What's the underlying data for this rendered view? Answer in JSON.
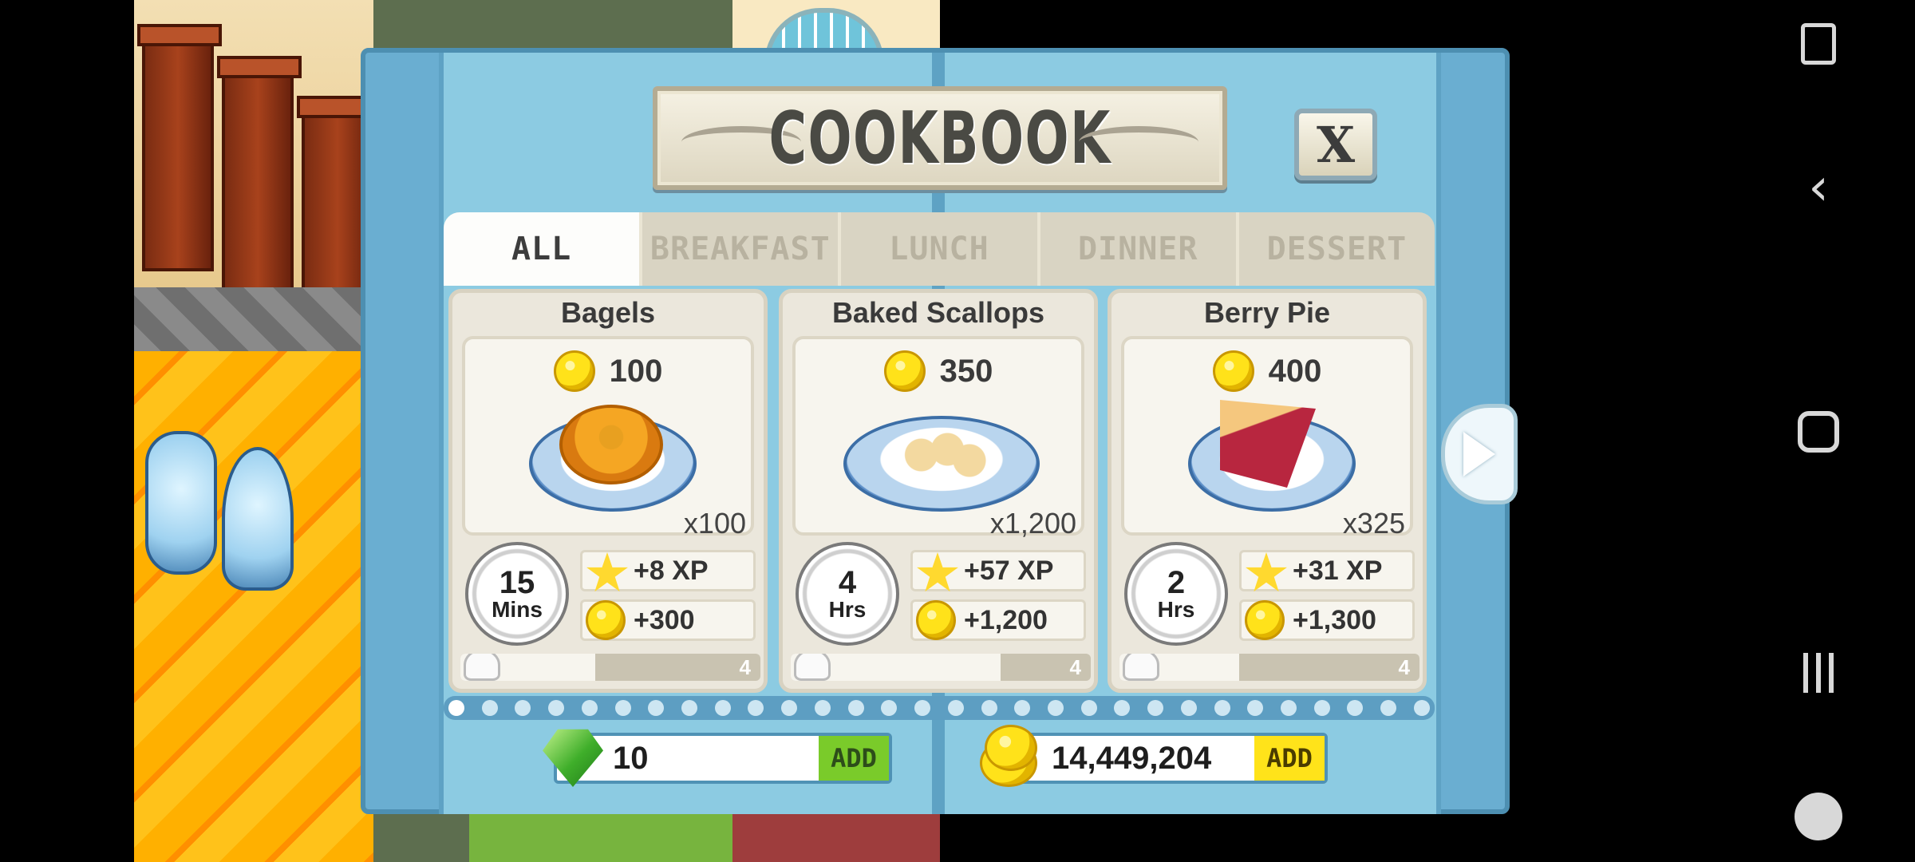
{
  "dialog": {
    "title": "COOKBOOK",
    "close_label": "X"
  },
  "tabs": [
    {
      "label": "ALL",
      "active": true
    },
    {
      "label": "BREAKFAST",
      "active": false
    },
    {
      "label": "LUNCH",
      "active": false
    },
    {
      "label": "DINNER",
      "active": false
    },
    {
      "label": "DESSERT",
      "active": false
    }
  ],
  "recipes": [
    {
      "name": "Bagels",
      "cost": "100",
      "servings": "x100",
      "time_value": "15",
      "time_unit": "Mins",
      "xp": "+8 XP",
      "coins": "+300",
      "level": "4",
      "mastery_fraction": 0.45
    },
    {
      "name": "Baked Scallops",
      "cost": "350",
      "servings": "x1,200",
      "time_value": "4",
      "time_unit": "Hrs",
      "xp": "+57 XP",
      "coins": "+1,200",
      "level": "4",
      "mastery_fraction": 0.7
    },
    {
      "name": "Berry Pie",
      "cost": "400",
      "servings": "x325",
      "time_value": "2",
      "time_unit": "Hrs",
      "xp": "+31 XP",
      "coins": "+1,300",
      "level": "4",
      "mastery_fraction": 0.4
    }
  ],
  "pager": {
    "total_pages": 30,
    "current_page": 1
  },
  "currency": {
    "gems": "10",
    "gold": "14,449,204",
    "add_label": "ADD"
  },
  "colors": {
    "dialog_blue": "#8ccbe2",
    "gem_add": "#7acb2a",
    "gold_add": "#ffe31a",
    "coin": "#ffe21a"
  },
  "icons": {
    "close": "close-icon",
    "next": "chevron-right-icon",
    "coin": "coin-icon",
    "star": "star-icon",
    "gem": "gem-icon",
    "timer": "timer-icon"
  }
}
